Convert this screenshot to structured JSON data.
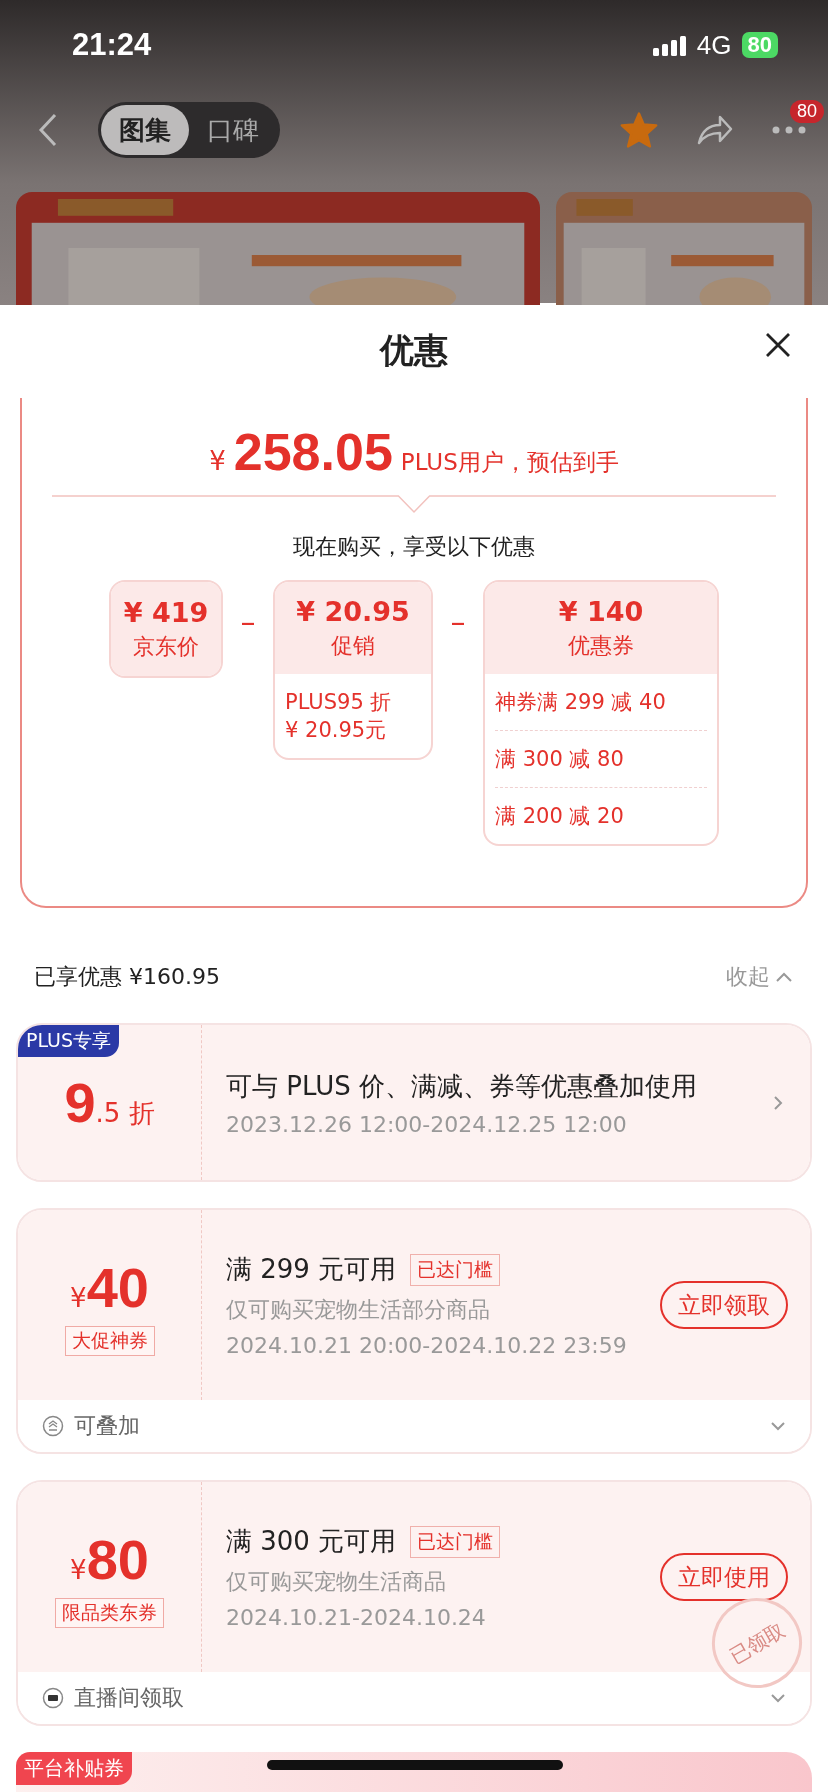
{
  "status_bar": {
    "time": "21:24",
    "network": "4G",
    "battery": "80"
  },
  "nav": {
    "tabs": [
      {
        "label": "图集",
        "selected": true
      },
      {
        "label": "口碑",
        "selected": false
      }
    ],
    "favorited": true,
    "badge": "80"
  },
  "sheet": {
    "title": "优惠",
    "estimate": {
      "currency": "¥",
      "price": "258.05",
      "note": "PLUS用户，预估到手"
    },
    "subtitle": "现在购买，享受以下优惠",
    "breakdown": [
      {
        "amount": "¥ 419",
        "label": "京东价"
      },
      {
        "operator": "–",
        "amount": "¥ 20.95",
        "label": "促销",
        "details": [
          "PLUS95 折\n¥ 20.95元"
        ]
      },
      {
        "operator": "–",
        "amount": "¥ 140",
        "label": "优惠券",
        "details": [
          "神券满 299 减 40",
          "满 300 减 80",
          "满 200 减 20"
        ]
      }
    ],
    "saved": "已享优惠 ¥160.95",
    "collapse": "收起",
    "coupons": [
      {
        "kind": "discount",
        "badge": "PLUS专享",
        "value_big": "9",
        "value_small": ".5 折",
        "title": "可与 PLUS 价、满减、券等优惠叠加使用",
        "period": "2023.12.26 12:00-2024.12.25 12:00"
      },
      {
        "kind": "coupon",
        "currency": "¥",
        "value": "40",
        "tag": "大促神券",
        "title": "满 299 元可用",
        "status": "已达门槛",
        "scope": "仅可购买宠物生活部分商品",
        "period": "2024.10.21 20:00-2024.10.22 23:59",
        "action": "立即领取",
        "footer": {
          "kind": "stack",
          "text": "可叠加"
        },
        "claimed": false
      },
      {
        "kind": "coupon",
        "currency": "¥",
        "value": "80",
        "tag": "限品类东券",
        "title": "满 300 元可用",
        "status": "已达门槛",
        "scope": "仅可购买宠物生活商品",
        "period": "2024.10.21-2024.10.24",
        "action": "立即使用",
        "footer": {
          "kind": "live",
          "text": "直播间领取"
        },
        "claimed": true,
        "stamp": "已领取"
      }
    ],
    "next_badge": "平台补贴券"
  }
}
